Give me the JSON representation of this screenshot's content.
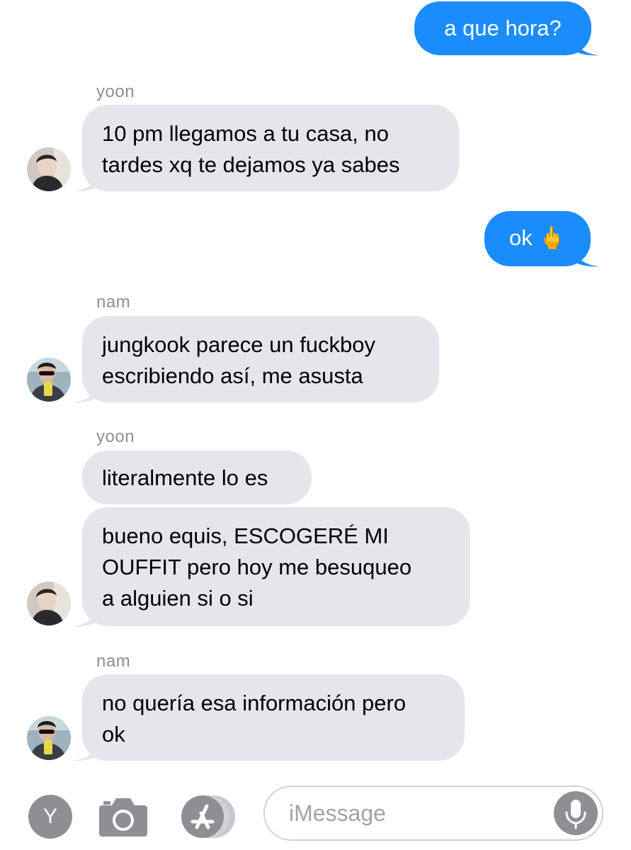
{
  "conversation": {
    "messages": [
      {
        "direction": "out",
        "text": "a que hora?"
      },
      {
        "direction": "in",
        "sender": "yoon",
        "lines": [
          "10 pm llegamos a tu casa, no",
          "tardes xq te dejamos ya sabes"
        ]
      },
      {
        "direction": "out",
        "text": "ok 🖕"
      },
      {
        "direction": "in",
        "sender": "nam",
        "lines": [
          "jungkook parece un fuckboy",
          "escribiendo así, me asusta"
        ]
      },
      {
        "direction": "in",
        "sender": "yoon",
        "lines": [
          "literalmente lo es"
        ]
      },
      {
        "direction": "in",
        "lines": [
          "bueno equis, ESCOGERÉ MI",
          "OUFFIT pero hoy me besuqueo",
          "a alguien si o si"
        ]
      },
      {
        "direction": "in",
        "sender": "nam",
        "lines": [
          "no quería esa información pero",
          "ok"
        ]
      }
    ]
  },
  "input_bar": {
    "avatar_letter": "Y",
    "placeholder": "iMessage",
    "icons": [
      "camera-icon",
      "app-store-icon",
      "microphone-icon"
    ]
  },
  "colors": {
    "outgoing_bubble": "#1b8cfb",
    "incoming_bubble": "#e5e5ea",
    "sender_label": "#8e8e93"
  }
}
